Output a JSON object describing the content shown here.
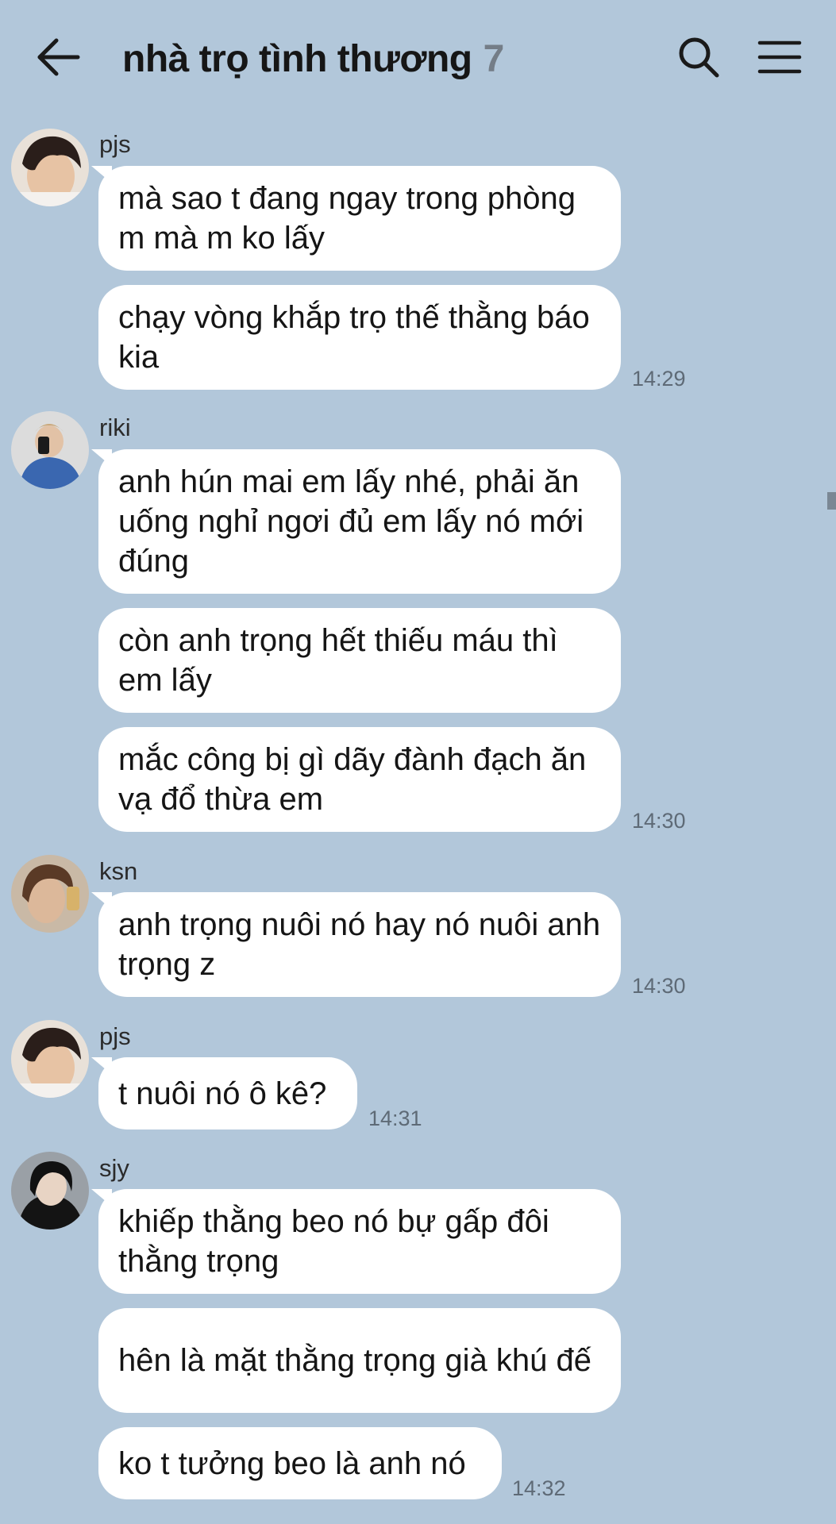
{
  "header": {
    "back_icon": "arrow-left-icon",
    "title": "nhà trọ tình thương",
    "member_count": "7",
    "search_icon": "search-icon",
    "menu_icon": "hamburger-menu-icon"
  },
  "messages": [
    {
      "sender": "pjs",
      "bubbles": [
        "mà sao t đang ngay trong phòng m mà m ko lấy",
        "chạy vòng khắp trọ thế thằng báo kia"
      ],
      "time": "14:29"
    },
    {
      "sender": "riki",
      "bubbles": [
        "anh hún mai em lấy nhé, phải ăn uống nghỉ ngơi đủ em lấy nó mới đúng",
        "còn anh trọng hết thiếu máu thì em lấy",
        "mắc công bị gì dãy đành đạch ăn vạ đổ thừa em"
      ],
      "time": "14:30"
    },
    {
      "sender": "ksn",
      "bubbles": [
        "anh trọng nuôi nó hay nó nuôi anh trọng z"
      ],
      "time": "14:30"
    },
    {
      "sender": "pjs",
      "bubbles": [
        "t nuôi nó ô kê?"
      ],
      "time": "14:31"
    },
    {
      "sender": "sjy",
      "bubbles": [
        "khiếp thằng beo nó bự gấp đôi thằng trọng",
        "hên là mặt thằng trọng già khú đế",
        "ko t tưởng beo là anh nó"
      ],
      "time": "14:32"
    }
  ]
}
